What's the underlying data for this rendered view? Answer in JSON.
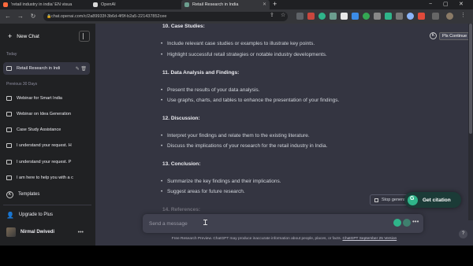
{
  "browser": {
    "tabs": [
      {
        "title": "'retail industry in india' EN visua",
        "active": false,
        "fav": "#ff6a3d"
      },
      {
        "title": "OpenAI",
        "active": false,
        "fav": "#d9d9d9"
      },
      {
        "title": "Retail Research in India",
        "active": true,
        "fav": "#6c9e8f"
      }
    ],
    "new_tab": "+",
    "window_controls": [
      "−",
      "▢",
      "✕"
    ],
    "url": "chat.openai.com/c/2a89933f-3b6d-4f9f-b2a5-221437852cee",
    "nav": [
      "←",
      "→",
      "↻"
    ]
  },
  "sidebar": {
    "new_chat": "New Chat",
    "sections": [
      {
        "label": "Today"
      },
      {
        "label": "Previous 30 Days"
      }
    ],
    "today_items": [
      {
        "label": "Retail Research in Indi",
        "active": true
      }
    ],
    "previous_items": [
      {
        "label": "Webinar for Smart India"
      },
      {
        "label": "Webinar on Idea Generation"
      },
      {
        "label": "Case Study Assistance"
      },
      {
        "label": "I understand your request. H"
      },
      {
        "label": "I understand your request. P"
      },
      {
        "label": "I am here to help you with a c"
      }
    ],
    "templates": "Templates",
    "upgrade": "Upgrade to Plus",
    "user_name": "Nirmal Dwivedi"
  },
  "content": {
    "sections": [
      {
        "heading": "10. Case Studies:",
        "items": [
          "Include relevant case studies or examples to illustrate key points.",
          "Highlight successful retail strategies or notable industry developments."
        ]
      },
      {
        "heading": "11. Data Analysis and Findings:",
        "items": [
          "Present the results of your data analysis.",
          "Use graphs, charts, and tables to enhance the presentation of your findings."
        ]
      },
      {
        "heading": "12. Discussion:",
        "items": [
          "Interpret your findings and relate them to the existing literature.",
          "Discuss the implications of your research for the retail industry in India."
        ]
      },
      {
        "heading": "13. Conclusion:",
        "items": [
          "Summarize the key findings and their implications.",
          "Suggest areas for future research."
        ]
      },
      {
        "heading": "14. References:",
        "items": []
      }
    ],
    "bullet": "•"
  },
  "continue_button": {
    "key": "K",
    "label": "Pls Continue"
  },
  "stop_button": "Stop generating",
  "citation_button": "Get citation",
  "input": {
    "placeholder": "Send a message",
    "value": ""
  },
  "footer": {
    "text": "Free Research Preview. ChatGPT may produce inaccurate information about people, places, or facts. ",
    "link": "ChatGPT September 25 Version"
  },
  "help": "?"
}
